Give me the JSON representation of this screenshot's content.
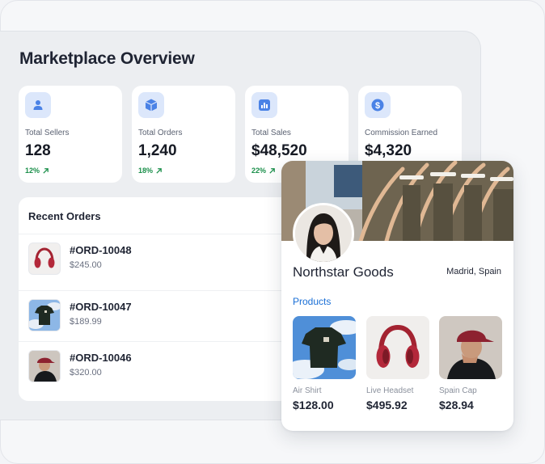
{
  "dashboard": {
    "title": "Marketplace Overview",
    "stats": [
      {
        "label": "Total Sellers",
        "value": "128",
        "trend": "12%",
        "icon": "user-icon"
      },
      {
        "label": "Total Orders",
        "value": "1,240",
        "trend": "18%",
        "icon": "box-icon"
      },
      {
        "label": "Total Sales",
        "value": "$48,520",
        "trend": "22%",
        "icon": "bar-chart-icon"
      },
      {
        "label": "Commission Earned",
        "value": "$4,320",
        "trend": "",
        "icon": "dollar-icon"
      }
    ],
    "recent_orders": {
      "title": "Recent Orders",
      "rows": [
        {
          "id": "#ORD-10048",
          "price": "$245.00",
          "thumb": "red-headphones"
        },
        {
          "id": "#ORD-10047",
          "price": "$189.99",
          "thumb": "black-tshirt"
        },
        {
          "id": "#ORD-10046",
          "price": "$320.00",
          "thumb": "person-red-cap"
        }
      ]
    }
  },
  "store": {
    "name": "Northstar Goods",
    "location": "Madrid, Spain",
    "products_label": "Products",
    "products": [
      {
        "name": "Air Shirt",
        "price": "$128.00"
      },
      {
        "name": "Live Headset",
        "price": "$495.92"
      },
      {
        "name": "Spain Cap",
        "price": "$28.94"
      }
    ]
  },
  "colors": {
    "accent_blue": "#1a6fd6",
    "trend_green": "#1a8f4a",
    "icon_tile": "#dce7fb",
    "icon_blue": "#4a82e6"
  }
}
